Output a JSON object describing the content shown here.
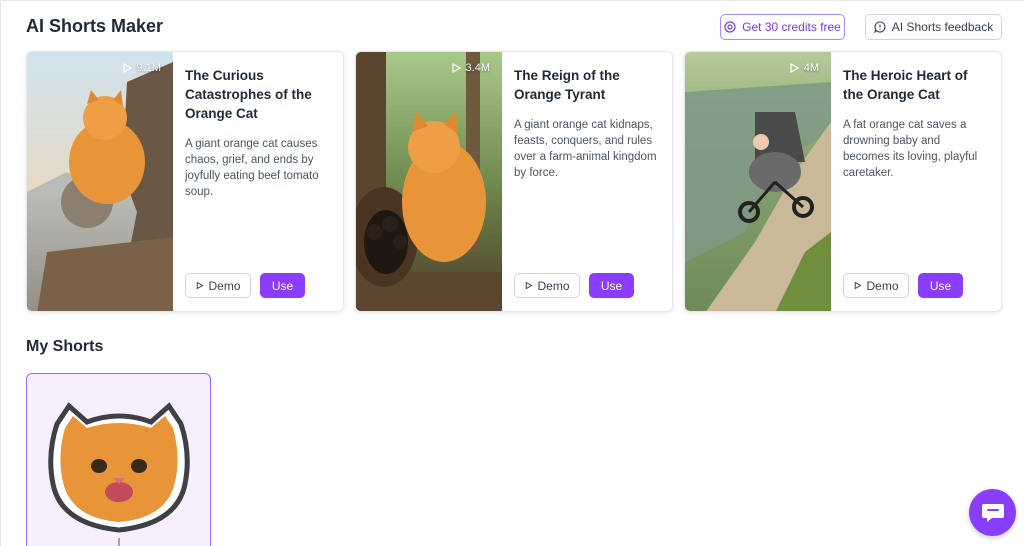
{
  "header": {
    "title": "AI Shorts Maker",
    "credits_label": "Get 30 credits free",
    "feedback_label": "AI Shorts feedback"
  },
  "templates": [
    {
      "views": "9.1M",
      "title": "The Curious Catastrophes of the Orange Cat",
      "description": "A giant orange cat causes chaos, grief, and ends by joyfully eating beef tomato soup.",
      "demo_label": "Demo",
      "use_label": "Use"
    },
    {
      "views": "3.4M",
      "title": "The Reign of the Orange Tyrant",
      "description": "A giant orange cat kidnaps, feasts, conquers, and rules over a farm-animal kingdom by force.",
      "demo_label": "Demo",
      "use_label": "Use"
    },
    {
      "views": "4M",
      "title": "The Heroic Heart of the Orange Cat",
      "description": "A fat orange cat saves a drowning baby and becomes its loving, playful caretaker.",
      "demo_label": "Demo",
      "use_label": "Use"
    }
  ],
  "my_shorts": {
    "title": "My Shorts"
  },
  "colors": {
    "accent": "#8b3dff",
    "accent_light": "#f6efff"
  }
}
